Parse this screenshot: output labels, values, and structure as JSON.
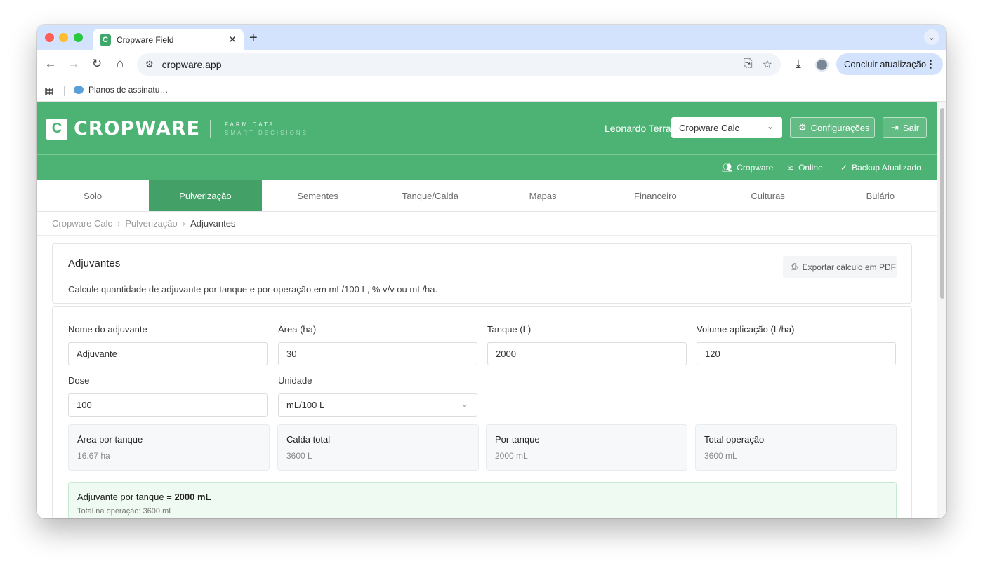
{
  "browser": {
    "tab_title": "Cropware Field",
    "tab_favicon": "C",
    "url": "cropware.app",
    "update_button": "Concluir atualização",
    "bookmark": "Planos de assinatu…"
  },
  "header": {
    "logo_mark": "C",
    "logo_text": "CROPWARE",
    "tagline_1": "FARM DATA",
    "tagline_2": "SMART DECISIONS",
    "user": "Leonardo Terra",
    "app_select": "Cropware Calc",
    "config_button": "Configurações",
    "exit_button": "Sair"
  },
  "status": {
    "org": "Cropware",
    "online": "Online",
    "backup": "Backup Atualizado"
  },
  "nav": {
    "tabs": [
      {
        "label": "Solo"
      },
      {
        "label": "Pulverização"
      },
      {
        "label": "Sementes"
      },
      {
        "label": "Tanque/Calda"
      },
      {
        "label": "Mapas"
      },
      {
        "label": "Financeiro"
      },
      {
        "label": "Culturas"
      },
      {
        "label": "Bulário"
      }
    ],
    "active": "Pulverização"
  },
  "breadcrumb": {
    "items": [
      "Cropware Calc",
      "Pulverização",
      "Adjuvantes"
    ]
  },
  "intro": {
    "title": "Adjuvantes",
    "description": "Calcule quantidade de adjuvante por tanque e por operação em mL/100 L, % v/v ou mL/ha.",
    "export_button": "Exportar cálculo em PDF"
  },
  "form": {
    "name": {
      "label": "Nome do adjuvante",
      "value": "Adjuvante"
    },
    "area": {
      "label": "Área (ha)",
      "value": "30"
    },
    "tank": {
      "label": "Tanque (L)",
      "value": "2000"
    },
    "volume": {
      "label": "Volume aplicação (L/ha)",
      "value": "120"
    },
    "dose": {
      "label": "Dose",
      "value": "100"
    },
    "unit": {
      "label": "Unidade",
      "value": "mL/100 L"
    }
  },
  "stats": [
    {
      "label": "Área por tanque",
      "value": "16.67 ha"
    },
    {
      "label": "Calda total",
      "value": "3600 L"
    },
    {
      "label": "Por tanque",
      "value": "2000 mL"
    },
    {
      "label": "Total operação",
      "value": "3600 mL"
    }
  ],
  "result": {
    "prefix": "Adjuvante por tanque =",
    "value": "2000 mL",
    "sub": "Total na operação: 3600 mL"
  },
  "colors": {
    "brand": "#4db374",
    "active_tab": "#43a066",
    "result_bg": "#effaf2"
  }
}
